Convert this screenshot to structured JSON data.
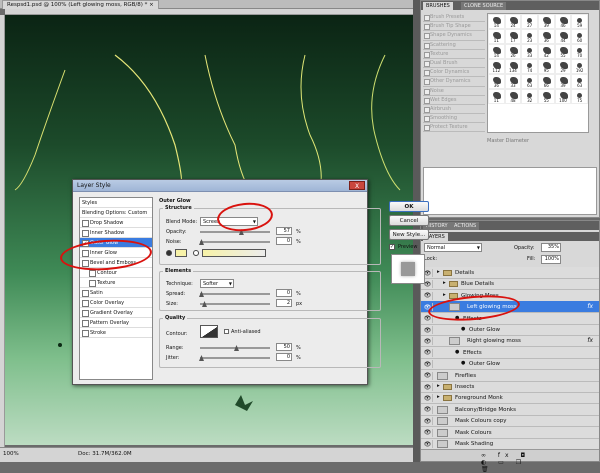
{
  "document": {
    "tab_title": "Respsd1.psd @ 100% (Left glowing moss, RGB/8) *",
    "close_glyph": "×",
    "zoom": "100%",
    "doc_info": "Doc: 31.7M/362.0M"
  },
  "brushes_panel": {
    "tabs": [
      "BRUSHES",
      "CLONE SOURCE"
    ],
    "options": [
      "Brush Presets",
      "Brush Tip Shape",
      "Shape Dynamics",
      "Scattering",
      "Texture",
      "Dual Brush",
      "Color Dynamics",
      "Other Dynamics",
      "Noise",
      "Wet Edges",
      "Airbrush",
      "Smoothing",
      "Protect Texture"
    ],
    "master_diameter": "Master Diameter",
    "brush_sizes": [
      "14",
      "24",
      "27",
      "39",
      "46",
      "59",
      "11",
      "17",
      "23",
      "36",
      "44",
      "60",
      "14",
      "26",
      "33",
      "42",
      "55",
      "70",
      "112",
      "134",
      "74",
      "95",
      "29",
      "192",
      "36",
      "33",
      "63",
      "66",
      "39",
      "63",
      "11",
      "48",
      "32",
      "55",
      "100",
      "75"
    ]
  },
  "layers_panel": {
    "tabs": [
      "HISTORY",
      "ACTIONS"
    ],
    "sub_tab": "LAYERS",
    "blend_mode": "Normal",
    "opacity_label": "Opacity:",
    "opacity_value": "35%",
    "lock_label": "Lock:",
    "fill_label": "Fill:",
    "fill_value": "100%",
    "rows": [
      {
        "name": "Details",
        "kind": "folder",
        "indent": 0
      },
      {
        "name": "Blue Details",
        "kind": "folder",
        "indent": 1
      },
      {
        "name": "Glowing Moss",
        "kind": "folder",
        "indent": 1
      },
      {
        "name": "Left glowing moss",
        "kind": "layer",
        "indent": 2,
        "selected": true,
        "fx": "fx"
      },
      {
        "name": "Effects",
        "kind": "effect",
        "indent": 3
      },
      {
        "name": "Outer Glow",
        "kind": "effect",
        "indent": 4
      },
      {
        "name": "Right glowing moss",
        "kind": "layer",
        "indent": 2,
        "fx": "fx"
      },
      {
        "name": "Effects",
        "kind": "effect",
        "indent": 3
      },
      {
        "name": "Outer Glow",
        "kind": "effect",
        "indent": 4
      },
      {
        "name": "Fireflies",
        "kind": "layer",
        "indent": 0
      },
      {
        "name": "Insects",
        "kind": "folder",
        "indent": 0
      },
      {
        "name": "Foreground Monk",
        "kind": "folder",
        "indent": 0
      },
      {
        "name": "Balcony/Bridge Monks",
        "kind": "layer",
        "indent": 0
      },
      {
        "name": "Mask Colours copy",
        "kind": "layer",
        "indent": 0
      },
      {
        "name": "Mask Colours",
        "kind": "layer",
        "indent": 0
      },
      {
        "name": "Mask Shading",
        "kind": "layer",
        "indent": 0
      }
    ],
    "footer_icons": "∞ fx ◘ ◐ ▭ ❐ 🗑"
  },
  "layer_style": {
    "title": "Layer Style",
    "close": "X",
    "styles": [
      {
        "label": "Styles",
        "type": "head"
      },
      {
        "label": "Blending Options: Custom",
        "type": "head"
      },
      {
        "label": "Drop Shadow",
        "type": "ck"
      },
      {
        "label": "Inner Shadow",
        "type": "ck"
      },
      {
        "label": "Outer Glow",
        "type": "ck",
        "selected": true
      },
      {
        "label": "Inner Glow",
        "type": "ck"
      },
      {
        "label": "Bevel and Emboss",
        "type": "ck"
      },
      {
        "label": "Contour",
        "type": "sub"
      },
      {
        "label": "Texture",
        "type": "sub"
      },
      {
        "label": "Satin",
        "type": "ck"
      },
      {
        "label": "Color Overlay",
        "type": "ck"
      },
      {
        "label": "Gradient Overlay",
        "type": "ck"
      },
      {
        "label": "Pattern Overlay",
        "type": "ck"
      },
      {
        "label": "Stroke",
        "type": "ck"
      }
    ],
    "heading": "Outer Glow",
    "structure": {
      "title": "Structure",
      "blend_mode_label": "Blend Mode:",
      "blend_mode": "Screen",
      "opacity_label": "Opacity:",
      "opacity": "57",
      "noise_label": "Noise:",
      "noise": "0",
      "pct": "%"
    },
    "elements": {
      "title": "Elements",
      "technique_label": "Technique:",
      "technique": "Softer",
      "spread_label": "Spread:",
      "spread": "0",
      "size_label": "Size:",
      "size": "2",
      "px": "px"
    },
    "quality": {
      "title": "Quality",
      "contour_label": "Contour:",
      "anti_aliased": "Anti-aliased",
      "range_label": "Range:",
      "range": "50",
      "jitter_label": "Jitter:",
      "jitter": "0"
    },
    "buttons": {
      "ok": "OK",
      "cancel": "Cancel",
      "new_style": "New Style...",
      "preview": "Preview"
    },
    "colors": {
      "glow": "#f7f2a8"
    }
  }
}
